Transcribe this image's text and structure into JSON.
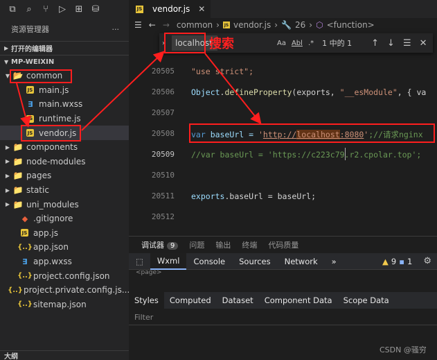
{
  "sidebar": {
    "explorer_title": "资源管理器",
    "more": "···",
    "open_editors": "打开的编辑器",
    "project": "MP-WEIXIN",
    "outline": "大纲",
    "items": [
      {
        "label": "common",
        "kind": "folder-open",
        "depth": 0
      },
      {
        "label": "main.js",
        "kind": "js",
        "depth": 1
      },
      {
        "label": "main.wxss",
        "kind": "css",
        "depth": 1
      },
      {
        "label": "runtime.js",
        "kind": "js",
        "depth": 1
      },
      {
        "label": "vendor.js",
        "kind": "js",
        "depth": 1
      },
      {
        "label": "components",
        "kind": "folder-special",
        "depth": 0
      },
      {
        "label": "node-modules",
        "kind": "folder",
        "depth": 0
      },
      {
        "label": "pages",
        "kind": "folder-special",
        "depth": 0
      },
      {
        "label": "static",
        "kind": "folder-special",
        "depth": 0
      },
      {
        "label": "uni_modules",
        "kind": "folder",
        "depth": 0
      },
      {
        "label": ".gitignore",
        "kind": "git",
        "depth": 0
      },
      {
        "label": "app.js",
        "kind": "js",
        "depth": 0
      },
      {
        "label": "app.json",
        "kind": "json",
        "depth": 0
      },
      {
        "label": "app.wxss",
        "kind": "css",
        "depth": 0
      },
      {
        "label": "project.config.json",
        "kind": "json",
        "depth": 0
      },
      {
        "label": "project.private.config.js...",
        "kind": "json",
        "depth": 0
      },
      {
        "label": "sitemap.json",
        "kind": "json",
        "depth": 0
      }
    ]
  },
  "editor": {
    "tab_title": "vendor.js",
    "breadcrumb": {
      "folder": "common",
      "file": "vendor.js",
      "symbol_count": "26",
      "symbol": "<function>"
    },
    "find": {
      "query": "localhost",
      "result": "1 中的 1",
      "case": "Aa",
      "word": "Abl",
      "regex": ".*"
    },
    "lines": [
      {
        "num": "20505"
      },
      {
        "num": "20506"
      },
      {
        "num": "20507"
      },
      {
        "num": "20508"
      },
      {
        "num": "20509"
      },
      {
        "num": "20510"
      },
      {
        "num": "20511"
      },
      {
        "num": "20512"
      }
    ],
    "code": {
      "l1": "\"use strict\";",
      "l2_a": "Object",
      "l2_b": ".",
      "l2_c": "defineProperty",
      "l2_d": "(exports, ",
      "l2_e": "\"__esModule\"",
      "l2_f": ", { va",
      "l4_kw": "var",
      "l4_name": " baseUrl = ",
      "l4_q1": "'",
      "l4_url1": "http://",
      "l4_url2": "localhost",
      "l4_url3": ":8080",
      "l4_q2": "'",
      "l4_cmt": ";//请求nginx",
      "l5": "//var baseUrl = 'https://c223c79.r2.cpolar.top';",
      "l7_a": "exports",
      "l7_b": ".baseUrl = baseUrl;"
    }
  },
  "annotation": {
    "label": "搜索"
  },
  "panel": {
    "tabs": [
      "调试器",
      "问题",
      "输出",
      "终端",
      "代码质量"
    ],
    "debugger_count": "9",
    "devtools_tabs": [
      "Wxml",
      "Console",
      "Sources",
      "Network"
    ],
    "warnings": "9",
    "errors": "1",
    "page_tag": "<page>",
    "style_tabs": [
      "Styles",
      "Computed",
      "Dataset",
      "Component Data",
      "Scope Data"
    ],
    "filter_placeholder": "Filter"
  },
  "watermark": "CSDN @骚穷"
}
